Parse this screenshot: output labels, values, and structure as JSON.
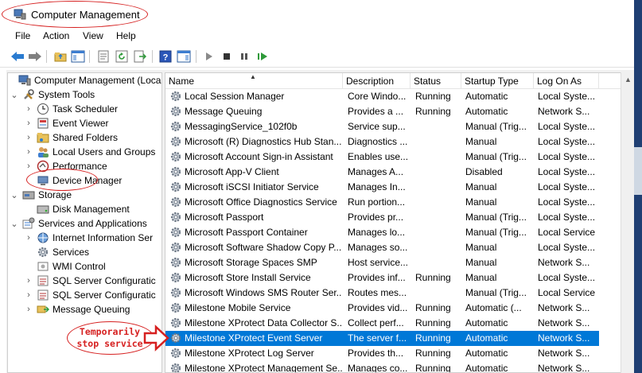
{
  "window": {
    "title": "Computer Management"
  },
  "menu": [
    "File",
    "Action",
    "View",
    "Help"
  ],
  "toolbar": {
    "buttons": [
      "back-icon",
      "forward-icon",
      "up-folder-icon",
      "show-hide-tree-icon",
      "properties-icon",
      "refresh-icon",
      "export-list-icon",
      "help-icon",
      "show-action-pane-icon",
      "start-service-icon",
      "stop-service-icon",
      "pause-service-icon",
      "restart-service-icon"
    ]
  },
  "tree": {
    "items": [
      {
        "label": "Computer Management (Local",
        "level": 0,
        "expander": "",
        "icon": "computer-icon"
      },
      {
        "label": "System Tools",
        "level": 1,
        "expander": "v",
        "icon": "tools-icon"
      },
      {
        "label": "Task Scheduler",
        "level": 2,
        "expander": ">",
        "icon": "clock-icon"
      },
      {
        "label": "Event Viewer",
        "level": 2,
        "expander": ">",
        "icon": "event-viewer-icon"
      },
      {
        "label": "Shared Folders",
        "level": 2,
        "expander": ">",
        "icon": "shared-folder-icon"
      },
      {
        "label": "Local Users and Groups",
        "level": 2,
        "expander": ">",
        "icon": "users-icon"
      },
      {
        "label": "Performance",
        "level": 2,
        "expander": ">",
        "icon": "performance-icon"
      },
      {
        "label": "Device Manager",
        "level": 2,
        "expander": "",
        "icon": "device-manager-icon"
      },
      {
        "label": "Storage",
        "level": 1,
        "expander": "v",
        "icon": "storage-icon"
      },
      {
        "label": "Disk Management",
        "level": 2,
        "expander": "",
        "icon": "disk-icon"
      },
      {
        "label": "Services and Applications",
        "level": 1,
        "expander": "v",
        "icon": "services-apps-icon"
      },
      {
        "label": "Internet Information Ser",
        "level": 2,
        "expander": ">",
        "icon": "iis-icon"
      },
      {
        "label": "Services",
        "level": 2,
        "expander": "",
        "icon": "gear-icon"
      },
      {
        "label": "WMI Control",
        "level": 2,
        "expander": "",
        "icon": "wmi-icon"
      },
      {
        "label": "SQL Server Configuratic",
        "level": 2,
        "expander": ">",
        "icon": "sql-icon"
      },
      {
        "label": "SQL Server Configuratic",
        "level": 2,
        "expander": ">",
        "icon": "sql-icon"
      },
      {
        "label": "Message Queuing",
        "level": 2,
        "expander": ">",
        "icon": "message-queue-icon"
      }
    ]
  },
  "list": {
    "columns": [
      "Name",
      "Description",
      "Status",
      "Startup Type",
      "Log On As"
    ],
    "rows": [
      [
        "Local Session Manager",
        "Core Windo...",
        "Running",
        "Automatic",
        "Local Syste..."
      ],
      [
        "Message Queuing",
        "Provides a ...",
        "Running",
        "Automatic",
        "Network S..."
      ],
      [
        "MessagingService_102f0b",
        "Service sup...",
        "",
        "Manual (Trig...",
        "Local Syste..."
      ],
      [
        "Microsoft (R) Diagnostics Hub Stan...",
        "Diagnostics ...",
        "",
        "Manual",
        "Local Syste..."
      ],
      [
        "Microsoft Account Sign-in Assistant",
        "Enables use...",
        "",
        "Manual (Trig...",
        "Local Syste..."
      ],
      [
        "Microsoft App-V Client",
        "Manages A...",
        "",
        "Disabled",
        "Local Syste..."
      ],
      [
        "Microsoft iSCSI Initiator Service",
        "Manages In...",
        "",
        "Manual",
        "Local Syste..."
      ],
      [
        "Microsoft Office Diagnostics Service",
        "Run portion...",
        "",
        "Manual",
        "Local Syste..."
      ],
      [
        "Microsoft Passport",
        "Provides pr...",
        "",
        "Manual (Trig...",
        "Local Syste..."
      ],
      [
        "Microsoft Passport Container",
        "Manages lo...",
        "",
        "Manual (Trig...",
        "Local Service"
      ],
      [
        "Microsoft Software Shadow Copy P...",
        "Manages so...",
        "",
        "Manual",
        "Local Syste..."
      ],
      [
        "Microsoft Storage Spaces SMP",
        "Host service...",
        "",
        "Manual",
        "Network S..."
      ],
      [
        "Microsoft Store Install Service",
        "Provides inf...",
        "Running",
        "Manual",
        "Local Syste..."
      ],
      [
        "Microsoft Windows SMS Router Ser...",
        "Routes mes...",
        "",
        "Manual (Trig...",
        "Local Service"
      ],
      [
        "Milestone Mobile Service",
        "Provides vid...",
        "Running",
        "Automatic (...",
        "Network S..."
      ],
      [
        "Milestone XProtect Data Collector S...",
        "Collect perf...",
        "Running",
        "Automatic",
        "Network S..."
      ],
      [
        "Milestone XProtect Event Server",
        "The server f...",
        "Running",
        "Automatic",
        "Network S..."
      ],
      [
        "Milestone XProtect Log Server",
        "Provides th...",
        "Running",
        "Automatic",
        "Network S..."
      ],
      [
        "Milestone XProtect Management Se...",
        "Manages co...",
        "Running",
        "Automatic",
        "Network S..."
      ]
    ],
    "selected_row": 16
  },
  "annotation": {
    "line1": "Temporarily",
    "line2": "stop service"
  },
  "colors": {
    "selection": "#0078d7",
    "annotation": "#d62020",
    "desktop": "#1f3f73"
  }
}
